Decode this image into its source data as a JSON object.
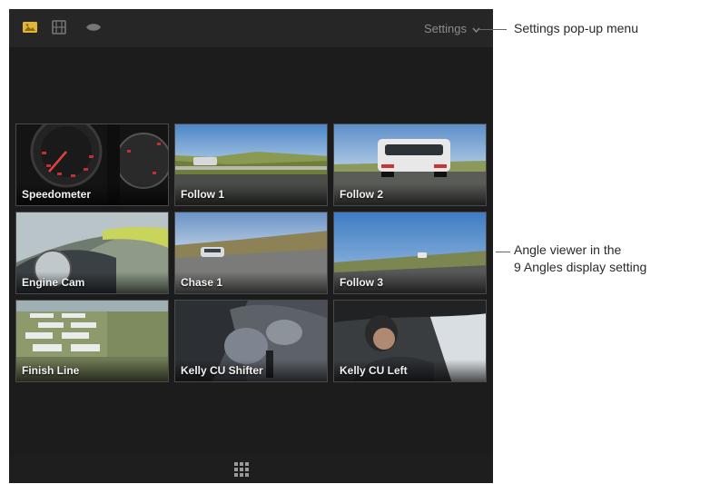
{
  "toolbar": {
    "icons": [
      "video-and-audio-icon",
      "video-only-icon",
      "audio-only-icon"
    ],
    "settings_label": "Settings",
    "settings_chevron": "⌄"
  },
  "angles": [
    {
      "label": "Speedometer"
    },
    {
      "label": "Follow 1"
    },
    {
      "label": "Follow 2"
    },
    {
      "label": "Engine Cam"
    },
    {
      "label": "Chase 1"
    },
    {
      "label": "Follow 3"
    },
    {
      "label": "Finish Line"
    },
    {
      "label": "Kelly CU Shifter"
    },
    {
      "label": "Kelly CU Left"
    }
  ],
  "callouts": {
    "settings_menu": "Settings pop-up menu",
    "angle_viewer_line1": "Angle viewer in the",
    "angle_viewer_line2": "9 Angles display setting"
  },
  "colors": {
    "active_icon": "#e0b53a",
    "inactive_icon": "#777777"
  }
}
